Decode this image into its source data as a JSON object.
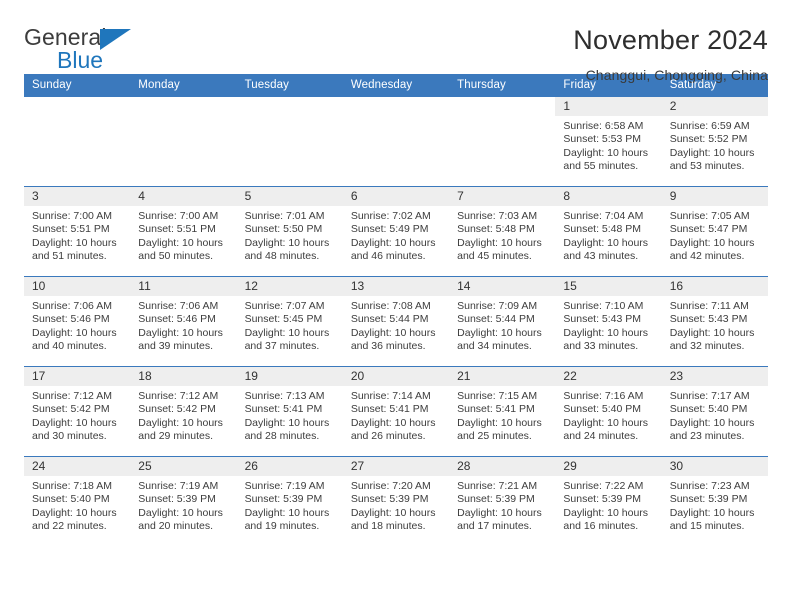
{
  "logo": {
    "word_one": "General",
    "word_two": "Blue",
    "triangle_icon": "triangle-icon",
    "brand_color": "#1f76bc"
  },
  "header": {
    "title": "November 2024",
    "subtitle": "Changgui, Chongqing, China"
  },
  "theme": {
    "header_blue": "#3b79bd",
    "daynum_band": "#eeeeee",
    "text": "#333333"
  },
  "calendar": {
    "weekday_headers": [
      "Sunday",
      "Monday",
      "Tuesday",
      "Wednesday",
      "Thursday",
      "Friday",
      "Saturday"
    ],
    "weeks": [
      [
        {
          "day": "",
          "empty": true
        },
        {
          "day": "",
          "empty": true
        },
        {
          "day": "",
          "empty": true
        },
        {
          "day": "",
          "empty": true
        },
        {
          "day": "",
          "empty": true
        },
        {
          "day": "1",
          "sunrise": "Sunrise: 6:58 AM",
          "sunset": "Sunset: 5:53 PM",
          "daylight": "Daylight: 10 hours and 55 minutes."
        },
        {
          "day": "2",
          "sunrise": "Sunrise: 6:59 AM",
          "sunset": "Sunset: 5:52 PM",
          "daylight": "Daylight: 10 hours and 53 minutes."
        }
      ],
      [
        {
          "day": "3",
          "sunrise": "Sunrise: 7:00 AM",
          "sunset": "Sunset: 5:51 PM",
          "daylight": "Daylight: 10 hours and 51 minutes."
        },
        {
          "day": "4",
          "sunrise": "Sunrise: 7:00 AM",
          "sunset": "Sunset: 5:51 PM",
          "daylight": "Daylight: 10 hours and 50 minutes."
        },
        {
          "day": "5",
          "sunrise": "Sunrise: 7:01 AM",
          "sunset": "Sunset: 5:50 PM",
          "daylight": "Daylight: 10 hours and 48 minutes."
        },
        {
          "day": "6",
          "sunrise": "Sunrise: 7:02 AM",
          "sunset": "Sunset: 5:49 PM",
          "daylight": "Daylight: 10 hours and 46 minutes."
        },
        {
          "day": "7",
          "sunrise": "Sunrise: 7:03 AM",
          "sunset": "Sunset: 5:48 PM",
          "daylight": "Daylight: 10 hours and 45 minutes."
        },
        {
          "day": "8",
          "sunrise": "Sunrise: 7:04 AM",
          "sunset": "Sunset: 5:48 PM",
          "daylight": "Daylight: 10 hours and 43 minutes."
        },
        {
          "day": "9",
          "sunrise": "Sunrise: 7:05 AM",
          "sunset": "Sunset: 5:47 PM",
          "daylight": "Daylight: 10 hours and 42 minutes."
        }
      ],
      [
        {
          "day": "10",
          "sunrise": "Sunrise: 7:06 AM",
          "sunset": "Sunset: 5:46 PM",
          "daylight": "Daylight: 10 hours and 40 minutes."
        },
        {
          "day": "11",
          "sunrise": "Sunrise: 7:06 AM",
          "sunset": "Sunset: 5:46 PM",
          "daylight": "Daylight: 10 hours and 39 minutes."
        },
        {
          "day": "12",
          "sunrise": "Sunrise: 7:07 AM",
          "sunset": "Sunset: 5:45 PM",
          "daylight": "Daylight: 10 hours and 37 minutes."
        },
        {
          "day": "13",
          "sunrise": "Sunrise: 7:08 AM",
          "sunset": "Sunset: 5:44 PM",
          "daylight": "Daylight: 10 hours and 36 minutes."
        },
        {
          "day": "14",
          "sunrise": "Sunrise: 7:09 AM",
          "sunset": "Sunset: 5:44 PM",
          "daylight": "Daylight: 10 hours and 34 minutes."
        },
        {
          "day": "15",
          "sunrise": "Sunrise: 7:10 AM",
          "sunset": "Sunset: 5:43 PM",
          "daylight": "Daylight: 10 hours and 33 minutes."
        },
        {
          "day": "16",
          "sunrise": "Sunrise: 7:11 AM",
          "sunset": "Sunset: 5:43 PM",
          "daylight": "Daylight: 10 hours and 32 minutes."
        }
      ],
      [
        {
          "day": "17",
          "sunrise": "Sunrise: 7:12 AM",
          "sunset": "Sunset: 5:42 PM",
          "daylight": "Daylight: 10 hours and 30 minutes."
        },
        {
          "day": "18",
          "sunrise": "Sunrise: 7:12 AM",
          "sunset": "Sunset: 5:42 PM",
          "daylight": "Daylight: 10 hours and 29 minutes."
        },
        {
          "day": "19",
          "sunrise": "Sunrise: 7:13 AM",
          "sunset": "Sunset: 5:41 PM",
          "daylight": "Daylight: 10 hours and 28 minutes."
        },
        {
          "day": "20",
          "sunrise": "Sunrise: 7:14 AM",
          "sunset": "Sunset: 5:41 PM",
          "daylight": "Daylight: 10 hours and 26 minutes."
        },
        {
          "day": "21",
          "sunrise": "Sunrise: 7:15 AM",
          "sunset": "Sunset: 5:41 PM",
          "daylight": "Daylight: 10 hours and 25 minutes."
        },
        {
          "day": "22",
          "sunrise": "Sunrise: 7:16 AM",
          "sunset": "Sunset: 5:40 PM",
          "daylight": "Daylight: 10 hours and 24 minutes."
        },
        {
          "day": "23",
          "sunrise": "Sunrise: 7:17 AM",
          "sunset": "Sunset: 5:40 PM",
          "daylight": "Daylight: 10 hours and 23 minutes."
        }
      ],
      [
        {
          "day": "24",
          "sunrise": "Sunrise: 7:18 AM",
          "sunset": "Sunset: 5:40 PM",
          "daylight": "Daylight: 10 hours and 22 minutes."
        },
        {
          "day": "25",
          "sunrise": "Sunrise: 7:19 AM",
          "sunset": "Sunset: 5:39 PM",
          "daylight": "Daylight: 10 hours and 20 minutes."
        },
        {
          "day": "26",
          "sunrise": "Sunrise: 7:19 AM",
          "sunset": "Sunset: 5:39 PM",
          "daylight": "Daylight: 10 hours and 19 minutes."
        },
        {
          "day": "27",
          "sunrise": "Sunrise: 7:20 AM",
          "sunset": "Sunset: 5:39 PM",
          "daylight": "Daylight: 10 hours and 18 minutes."
        },
        {
          "day": "28",
          "sunrise": "Sunrise: 7:21 AM",
          "sunset": "Sunset: 5:39 PM",
          "daylight": "Daylight: 10 hours and 17 minutes."
        },
        {
          "day": "29",
          "sunrise": "Sunrise: 7:22 AM",
          "sunset": "Sunset: 5:39 PM",
          "daylight": "Daylight: 10 hours and 16 minutes."
        },
        {
          "day": "30",
          "sunrise": "Sunrise: 7:23 AM",
          "sunset": "Sunset: 5:39 PM",
          "daylight": "Daylight: 10 hours and 15 minutes."
        }
      ]
    ]
  }
}
